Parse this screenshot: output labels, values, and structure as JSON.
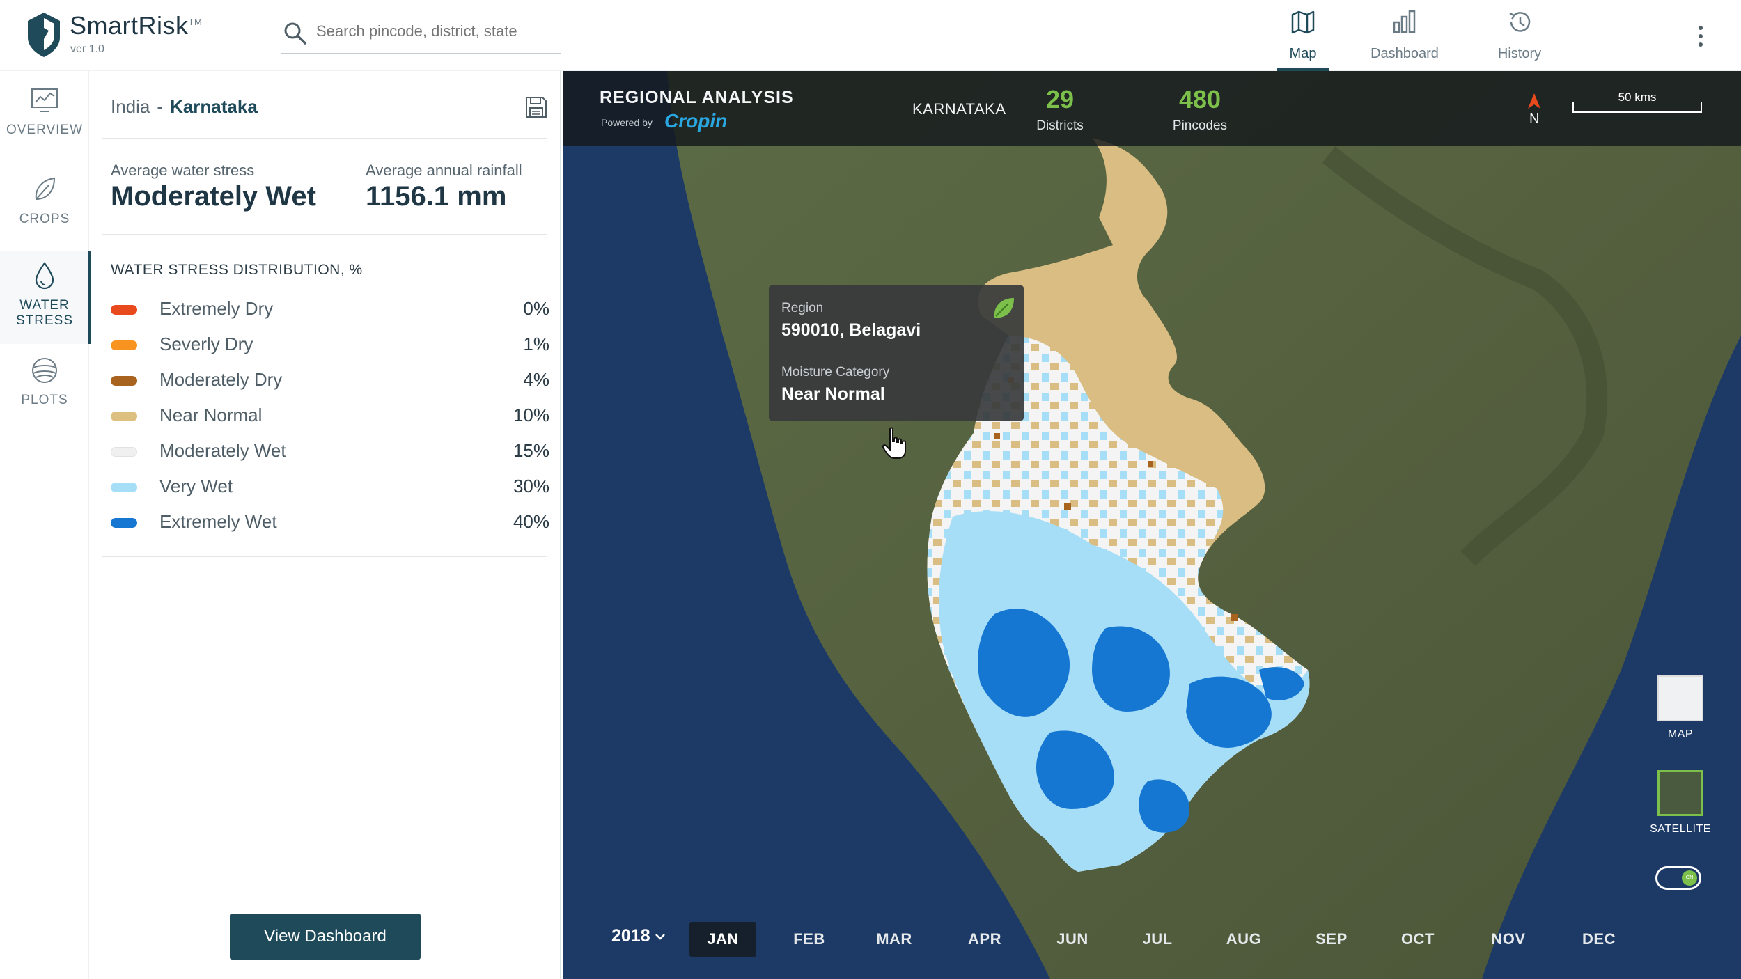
{
  "app": {
    "name": "SmartRisk",
    "trademark": "TM",
    "version": "ver 1.0"
  },
  "search": {
    "placeholder": "Search pincode, district, state"
  },
  "top_nav": {
    "tabs": [
      {
        "label": "Map",
        "icon": "map-icon",
        "active": true
      },
      {
        "label": "Dashboard",
        "icon": "bar-chart-icon",
        "active": false
      },
      {
        "label": "History",
        "icon": "history-icon",
        "active": false
      }
    ]
  },
  "left_nav": {
    "items": [
      {
        "label": "OVERVIEW",
        "icon": "monitor-chart-icon"
      },
      {
        "label": "CROPS",
        "icon": "leaf-icon"
      },
      {
        "label": "WATER",
        "label2": "STRESS",
        "icon": "water-drop-icon",
        "active": true
      },
      {
        "label": "PLOTS",
        "icon": "globe-plot-icon"
      }
    ]
  },
  "panel": {
    "breadcrumb": {
      "country": "India",
      "separator": "-",
      "state": "Karnataka"
    },
    "stats": {
      "water_label": "Average water stress",
      "water_value": "Moderately Wet",
      "rain_label": "Average annual rainfall",
      "rain_value": "1156.1 mm"
    },
    "distribution_title": "WATER STRESS DISTRIBUTION, %",
    "distribution": [
      {
        "label": "Extremely Dry",
        "value": "0%",
        "color": "#e8491d"
      },
      {
        "label": "Severly Dry",
        "value": "1%",
        "color": "#f7931e"
      },
      {
        "label": "Moderately Dry",
        "value": "4%",
        "color": "#a8641e"
      },
      {
        "label": "Near Normal",
        "value": "10%",
        "color": "#ddc07f"
      },
      {
        "label": "Moderately Wet",
        "value": "15%",
        "color": "#f0f0f0"
      },
      {
        "label": "Very Wet",
        "value": "30%",
        "color": "#a6ddf7"
      },
      {
        "label": "Extremely Wet",
        "value": "40%",
        "color": "#1677d2"
      }
    ],
    "view_dashboard": "View Dashboard"
  },
  "map": {
    "header": {
      "title": "REGIONAL ANALYSIS",
      "powered_by": "Powered by",
      "brand": "Cropin",
      "state": "KARNATAKA",
      "districts_count": "29",
      "districts_label": "Districts",
      "pincodes_count": "480",
      "pincodes_label": "Pincodes",
      "compass": "N",
      "scale": "50 kms"
    },
    "tooltip": {
      "region_label": "Region",
      "region_value": "590010, Belagavi",
      "moisture_label": "Moisture Category",
      "moisture_value": "Near Normal"
    },
    "layers": {
      "map": "MAP",
      "satellite": "SATELLITE",
      "toggle": "ON"
    },
    "timeline": {
      "year": "2018",
      "months": [
        "JAN",
        "FEB",
        "MAR",
        "APR",
        "JUN",
        "JUL",
        "AUG",
        "SEP",
        "OCT",
        "NOV",
        "DEC"
      ],
      "active_month": "JAN"
    }
  }
}
